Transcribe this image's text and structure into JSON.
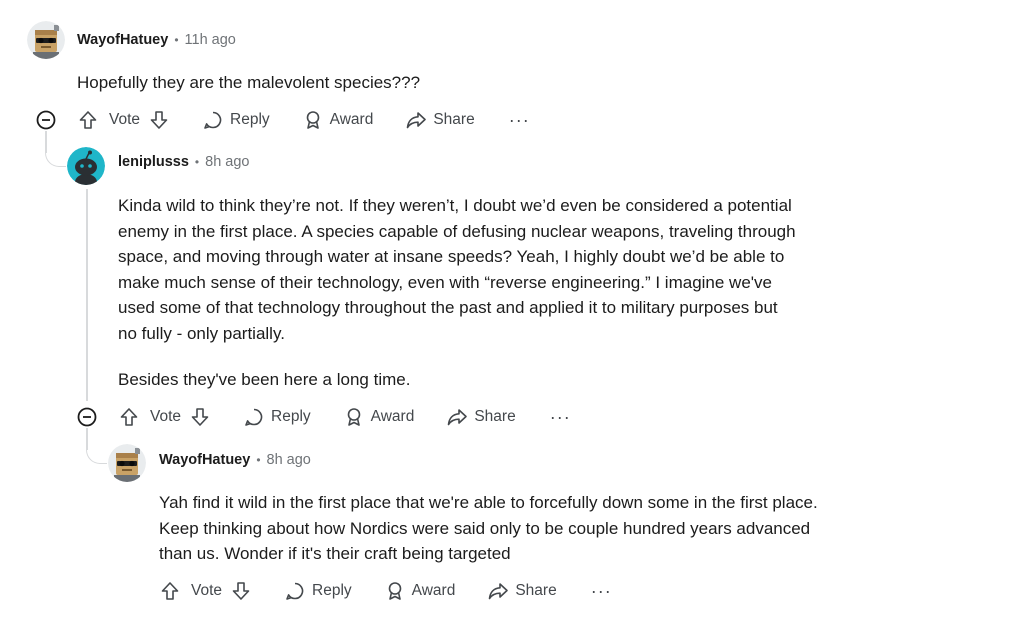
{
  "comments": [
    {
      "author": "WayofHatuey",
      "separator": "•",
      "time": "11h ago",
      "body": [
        "Hopefully they are the malevolent species???"
      ],
      "actions": {
        "vote": "Vote",
        "reply": "Reply",
        "award": "Award",
        "share": "Share",
        "more": "···"
      },
      "avatar_icon": "snoo-sunglasses-avatar-icon"
    },
    {
      "author": "leniplusss",
      "separator": "•",
      "time": "8h ago",
      "body": [
        "Kinda wild to think they’re not. If they weren’t, I doubt we’d even be considered a potential enemy in the first place. A species capable of defusing nuclear weapons, traveling through space, and moving through water at insane speeds? Yeah, I highly doubt we’d be able to make much sense of their technology, even with “reverse engineering.” I imagine we've used some of that technology throughout the past and applied it to military purposes but no fully - only partially.",
        "Besides they've been here a long time."
      ],
      "actions": {
        "vote": "Vote",
        "reply": "Reply",
        "award": "Award",
        "share": "Share",
        "more": "···"
      },
      "avatar_icon": "snoo-default-avatar-icon"
    },
    {
      "author": "WayofHatuey",
      "separator": "•",
      "time": "8h ago",
      "body": [
        "Yah find it wild in the first place that we're able to forcefully down some in the first place. Keep thinking about how Nordics were said only to be couple hundred years advanced than us. Wonder if it's their craft being targeted"
      ],
      "actions": {
        "vote": "Vote",
        "reply": "Reply",
        "award": "Award",
        "share": "Share",
        "more": "···"
      },
      "avatar_icon": "snoo-sunglasses-avatar-icon"
    }
  ],
  "colors": {
    "text": "#1c1c1c",
    "meta": "#6f7377",
    "action": "#44484c",
    "thread": "#d8dadc",
    "teal": "#1fb6c9"
  }
}
